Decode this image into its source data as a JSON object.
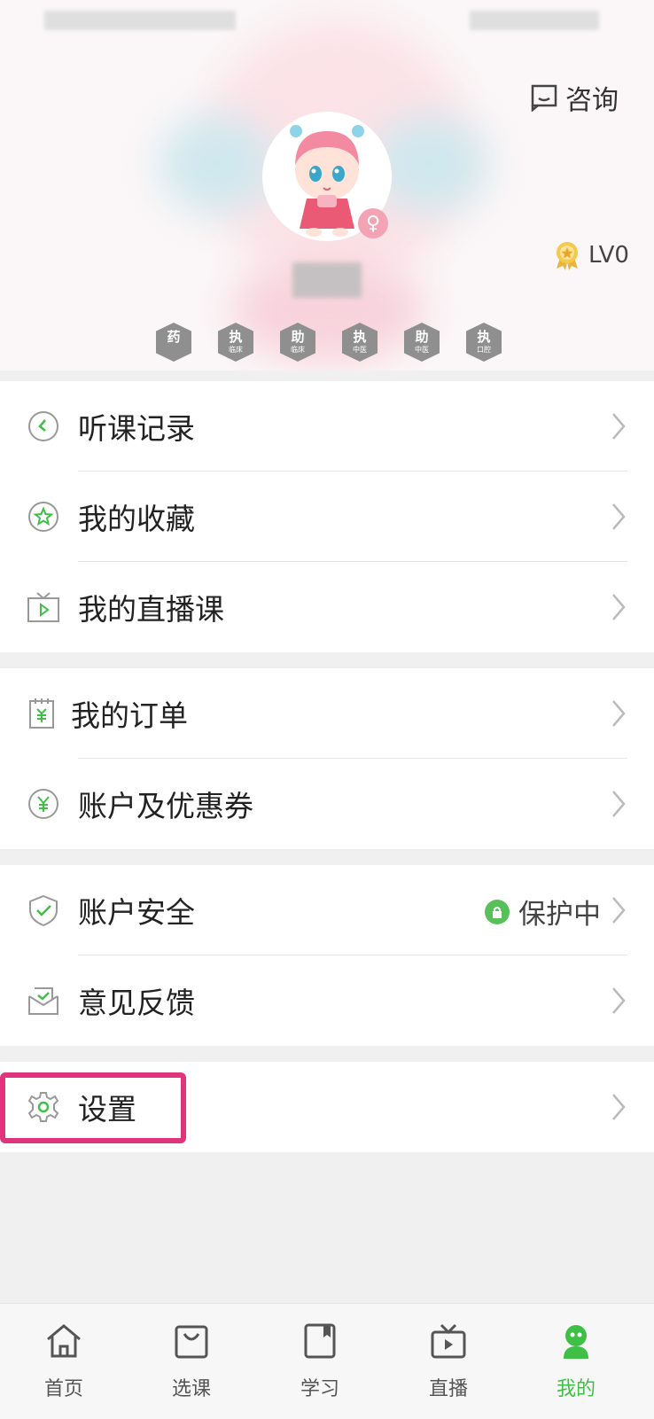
{
  "header": {
    "consult_label": "咨询",
    "level_label": "LV0",
    "gender_symbol": "♀",
    "badges": [
      {
        "main": "药",
        "sub": ""
      },
      {
        "main": "执",
        "sub": "临床"
      },
      {
        "main": "助",
        "sub": "临床"
      },
      {
        "main": "执",
        "sub": "中医"
      },
      {
        "main": "助",
        "sub": "中医"
      },
      {
        "main": "执",
        "sub": "口腔"
      }
    ]
  },
  "menu": {
    "listen_history": "听课记录",
    "favorites": "我的收藏",
    "live_courses": "我的直播课",
    "orders": "我的订单",
    "account_coupons": "账户及优惠券",
    "account_security": "账户安全",
    "security_status": "保护中",
    "feedback": "意见反馈",
    "settings": "设置"
  },
  "tabbar": {
    "home": "首页",
    "select_course": "选课",
    "study": "学习",
    "live": "直播",
    "mine": "我的"
  },
  "colors": {
    "accent_green": "#3fbf46",
    "highlight_pink": "#e0347d"
  }
}
